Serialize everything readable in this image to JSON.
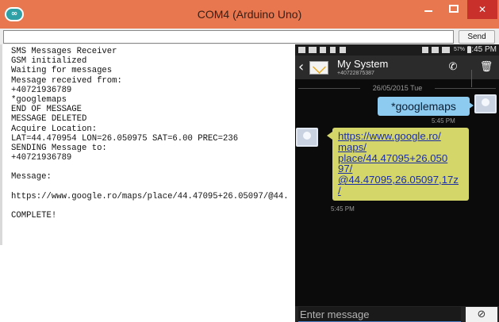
{
  "window": {
    "title": "COM4 (Arduino Uno)",
    "logo_glyph": "∞",
    "minimize_glyph": "",
    "close_glyph": "✕"
  },
  "toolbar": {
    "input_value": "",
    "send_label": "Send"
  },
  "serial_lines": [
    "SMS Messages Receiver",
    "GSM initialized",
    "Waiting for messages",
    "Message received from:",
    "+40721936789",
    "*googlemaps",
    "END OF MESSAGE",
    "MESSAGE DELETED",
    "Acquire Location:",
    "LAT=44.470954 LON=26.050975 SAT=6.00 PREC=236",
    "SENDING Message to:",
    "+40721936789",
    "",
    "Message:",
    "",
    "https://www.google.ro/maps/place/44.47095+26.05097/@44.",
    "",
    "COMPLETE!"
  ],
  "phone": {
    "status": {
      "time": "5:45 PM",
      "battery": "57%"
    },
    "contact": {
      "name": "My System",
      "number": "+40722875387"
    },
    "icons": {
      "back": "‹",
      "call": "✆",
      "delete": "🗑",
      "attach": "⊘"
    },
    "date_divider": "26/05/2015 Tue",
    "messages": {
      "sent": {
        "text": "*googlemaps",
        "time": "5:45 PM"
      },
      "received": {
        "lines": [
          "https://www.google.ro/",
          "maps/",
          "place/44.47095+26.050",
          "97/",
          "@44.47095,26.05097,17z",
          "/"
        ],
        "time": "5:45 PM"
      }
    },
    "compose": {
      "placeholder": "Enter message"
    }
  },
  "colors": {
    "titlebar": "#e8764f",
    "close_button": "#c9302c",
    "sent_bubble": "#8ecbf0",
    "received_bubble": "#d5d66a",
    "link": "#1c2fa6"
  }
}
